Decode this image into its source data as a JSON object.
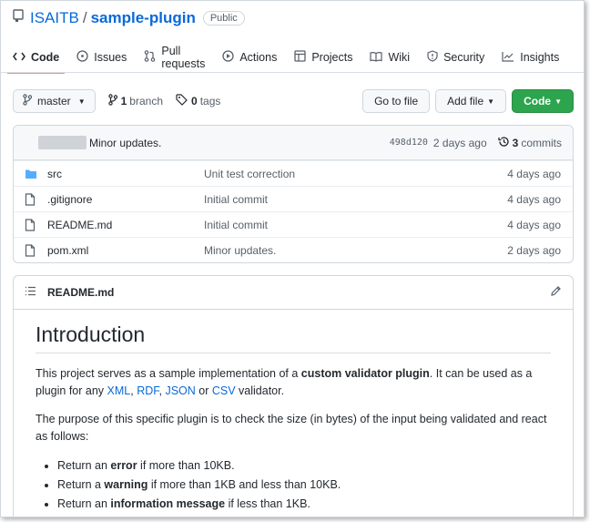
{
  "repo": {
    "owner": "ISAITB",
    "slash": "/",
    "name": "sample-plugin",
    "visibility": "Public"
  },
  "tabs": [
    {
      "label": "Code",
      "icon": "code-icon",
      "active": true
    },
    {
      "label": "Issues",
      "icon": "issue-icon"
    },
    {
      "label": "Pull requests",
      "icon": "pull-request-icon"
    },
    {
      "label": "Actions",
      "icon": "play-icon"
    },
    {
      "label": "Projects",
      "icon": "table-icon"
    },
    {
      "label": "Wiki",
      "icon": "book-icon"
    },
    {
      "label": "Security",
      "icon": "shield-icon"
    },
    {
      "label": "Insights",
      "icon": "graph-icon"
    }
  ],
  "toolbar": {
    "branch": "master",
    "branch_count": "1",
    "branch_word": "branch",
    "tag_count": "0",
    "tag_word": "tags",
    "go_to_file": "Go to file",
    "add_file": "Add file",
    "code": "Code"
  },
  "latest_commit": {
    "message": "Minor updates.",
    "hash": "498d120",
    "time": "2 days ago",
    "count": "3",
    "count_word": "commits"
  },
  "files": [
    {
      "name": "src",
      "type": "folder",
      "message": "Unit test correction",
      "age": "4 days ago"
    },
    {
      "name": ".gitignore",
      "type": "file",
      "message": "Initial commit",
      "age": "4 days ago"
    },
    {
      "name": "README.md",
      "type": "file",
      "message": "Initial commit",
      "age": "4 days ago"
    },
    {
      "name": "pom.xml",
      "type": "file",
      "message": "Minor updates.",
      "age": "2 days ago"
    }
  ],
  "readme": {
    "filename": "README.md",
    "heading": "Introduction",
    "p1": {
      "a": "This project serves as a sample implementation of a ",
      "b_bold": "custom validator plugin",
      "c": ". It can be used as a plugin for any ",
      "link_xml": "XML",
      "sep1": ", ",
      "link_rdf": "RDF",
      "sep2": ", ",
      "link_json": "JSON",
      "or": " or ",
      "link_csv": "CSV",
      "end": " validator."
    },
    "p2": "The purpose of this specific plugin is to check the size (in bytes) of the input being validated and react as follows:",
    "bullets": [
      {
        "pre": "Return an ",
        "bold": "error",
        "post": " if more than 10KB."
      },
      {
        "pre": "Return a ",
        "bold": "warning",
        "post": " if more than 1KB and less than 10KB."
      },
      {
        "pre": "Return an ",
        "bold": "information message",
        "post": " if less than 1KB."
      }
    ]
  },
  "colors": {
    "link": "#0969da",
    "primary_button": "#2da44e",
    "active_tab_underline": "#fd8c73",
    "folder_icon": "#54aeff"
  }
}
